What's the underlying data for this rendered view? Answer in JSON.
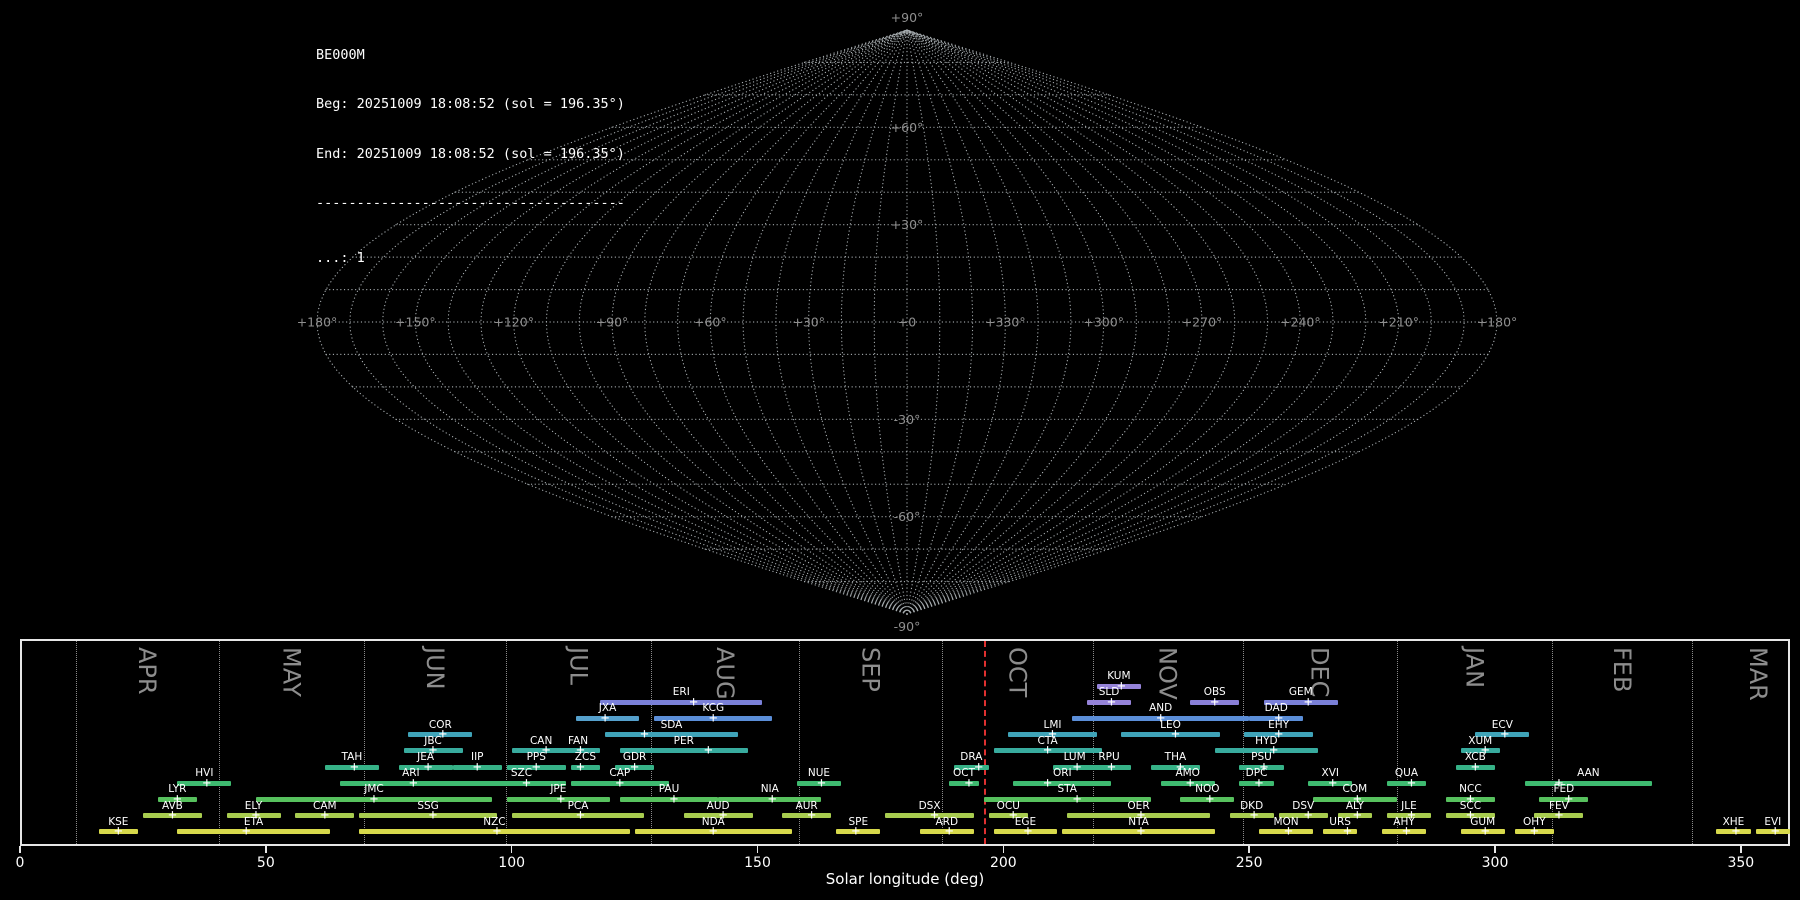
{
  "header": {
    "station": "BE000M",
    "beg_line": "Beg: 20251009 18:08:52 (sol = 196.35°)",
    "end_line": "End: 20251009 18:08:52 (sol = 196.35°)",
    "separator": "--------------------------------------",
    "legend_line": "...: 1"
  },
  "skymap": {
    "lon_labels": [
      {
        "off": -180,
        "label": "+180°"
      },
      {
        "off": -150,
        "label": "+150°"
      },
      {
        "off": -120,
        "label": "+120°"
      },
      {
        "off": -90,
        "label": "+90°"
      },
      {
        "off": -60,
        "label": "+60°"
      },
      {
        "off": -30,
        "label": "+30°"
      },
      {
        "off": 0,
        "label": "+0"
      },
      {
        "off": 30,
        "label": "+330°"
      },
      {
        "off": 60,
        "label": "+300°"
      },
      {
        "off": 90,
        "label": "+270°"
      },
      {
        "off": 120,
        "label": "+240°"
      },
      {
        "off": 150,
        "label": "+210°"
      },
      {
        "off": 180,
        "label": "+180°"
      }
    ],
    "lat_labels": [
      {
        "lat": 90,
        "label": "+90°"
      },
      {
        "lat": 60,
        "label": "+60°"
      },
      {
        "lat": 30,
        "label": "+30°"
      },
      {
        "lat": -30,
        "label": "-30°"
      },
      {
        "lat": -60,
        "label": "-60°"
      },
      {
        "lat": -90,
        "label": "-90°"
      }
    ]
  },
  "chart_data": {
    "type": "timeline",
    "title": "Meteor shower activity periods",
    "xlabel": "Solar longitude (deg)",
    "xlim": [
      0,
      360
    ],
    "x_ticks": [
      0,
      50,
      100,
      150,
      200,
      250,
      300,
      350
    ],
    "current_sol": 196.35,
    "months": [
      {
        "label": "APR",
        "start_sol": 11.3,
        "mid_sol": 25.8
      },
      {
        "label": "MAY",
        "start_sol": 40.4,
        "mid_sol": 55.2
      },
      {
        "label": "JUN",
        "start_sol": 70.0,
        "mid_sol": 84.4
      },
      {
        "label": "JUL",
        "start_sol": 98.8,
        "mid_sol": 113.6
      },
      {
        "label": "AUG",
        "start_sol": 128.4,
        "mid_sol": 143.4
      },
      {
        "label": "SEP",
        "start_sol": 158.4,
        "mid_sol": 173.0
      },
      {
        "label": "OCT",
        "start_sol": 187.6,
        "mid_sol": 202.9
      },
      {
        "label": "NOV",
        "start_sol": 218.2,
        "mid_sol": 233.4
      },
      {
        "label": "DEC",
        "start_sol": 248.7,
        "mid_sol": 264.3
      },
      {
        "label": "JAN",
        "start_sol": 280.0,
        "mid_sol": 295.8
      },
      {
        "label": "FEB",
        "start_sol": 311.6,
        "mid_sol": 325.8
      },
      {
        "label": "MAR",
        "start_sol": 340.0,
        "mid_sol": 353.5
      }
    ],
    "showers": [
      {
        "code": "KUM",
        "row": 1,
        "start": 219,
        "end": 228,
        "peak": 224,
        "color": "#9583d9"
      },
      {
        "code": "ERI",
        "row": 2,
        "start": 118,
        "end": 151,
        "peak": 137,
        "color": "#7a80d8"
      },
      {
        "code": "SLD",
        "row": 2,
        "start": 217,
        "end": 226,
        "peak": 222,
        "color": "#9583d9"
      },
      {
        "code": "OBS",
        "row": 2,
        "start": 238,
        "end": 248,
        "peak": 243,
        "color": "#8a80d8"
      },
      {
        "code": "GEM",
        "row": 2,
        "start": 253,
        "end": 268,
        "peak": 262,
        "color": "#7a80d8"
      },
      {
        "code": "JXA",
        "row": 3,
        "start": 113,
        "end": 126,
        "peak": 119,
        "color": "#55a0cc"
      },
      {
        "code": "KCG",
        "row": 3,
        "start": 129,
        "end": 153,
        "peak": 141,
        "color": "#5b8ed8"
      },
      {
        "code": "AND",
        "row": 3,
        "start": 214,
        "end": 250,
        "peak": 232,
        "color": "#5b8ed8"
      },
      {
        "code": "DAD",
        "row": 3,
        "start": 250,
        "end": 261,
        "peak": 256,
        "color": "#5b8ed8"
      },
      {
        "code": "COR",
        "row": 4,
        "start": 79,
        "end": 92,
        "peak": 86,
        "color": "#3fa3b8"
      },
      {
        "code": "SDA",
        "row": 4,
        "start": 119,
        "end": 146,
        "peak": 127,
        "color": "#3fa3b8"
      },
      {
        "code": "LMI",
        "row": 4,
        "start": 201,
        "end": 219,
        "peak": 210,
        "color": "#3fa3b8"
      },
      {
        "code": "LEO",
        "row": 4,
        "start": 224,
        "end": 244,
        "peak": 235,
        "color": "#3fa3b8"
      },
      {
        "code": "EHY",
        "row": 4,
        "start": 249,
        "end": 263,
        "peak": 256,
        "color": "#3fa3b8"
      },
      {
        "code": "ECV",
        "row": 4,
        "start": 296,
        "end": 307,
        "peak": 302,
        "color": "#3fa3b8"
      },
      {
        "code": "JBC",
        "row": 5,
        "start": 78,
        "end": 90,
        "peak": 84,
        "color": "#38ab9e"
      },
      {
        "code": "CAN",
        "row": 5,
        "start": 100,
        "end": 112,
        "peak": 107,
        "color": "#38ab9e"
      },
      {
        "code": "FAN",
        "row": 5,
        "start": 109,
        "end": 118,
        "peak": 114,
        "color": "#38ab9e"
      },
      {
        "code": "PER",
        "row": 5,
        "start": 122,
        "end": 148,
        "peak": 140,
        "color": "#38ab9e"
      },
      {
        "code": "CTA",
        "row": 5,
        "start": 198,
        "end": 220,
        "peak": 209,
        "color": "#38ab9e"
      },
      {
        "code": "HYD",
        "row": 5,
        "start": 243,
        "end": 264,
        "peak": 255,
        "color": "#38ab9e"
      },
      {
        "code": "XUM",
        "row": 5,
        "start": 293,
        "end": 301,
        "peak": 298,
        "color": "#38ab9e"
      },
      {
        "code": "TAH",
        "row": 6,
        "start": 62,
        "end": 73,
        "peak": 68,
        "color": "#36b287"
      },
      {
        "code": "JEA",
        "row": 6,
        "start": 77,
        "end": 88,
        "peak": 83,
        "color": "#36b287"
      },
      {
        "code": "IIP",
        "row": 6,
        "start": 88,
        "end": 98,
        "peak": 93,
        "color": "#36b287"
      },
      {
        "code": "PPS",
        "row": 6,
        "start": 99,
        "end": 111,
        "peak": 105,
        "color": "#36b287"
      },
      {
        "code": "ZCS",
        "row": 6,
        "start": 112,
        "end": 118,
        "peak": 114,
        "color": "#36b287"
      },
      {
        "code": "GDR",
        "row": 6,
        "start": 121,
        "end": 129,
        "peak": 125,
        "color": "#36b287"
      },
      {
        "code": "DRA",
        "row": 6,
        "start": 190,
        "end": 197,
        "peak": 195,
        "color": "#36b287"
      },
      {
        "code": "LUM",
        "row": 6,
        "start": 210,
        "end": 219,
        "peak": 215,
        "color": "#36b287"
      },
      {
        "code": "RPU",
        "row": 6,
        "start": 217,
        "end": 226,
        "peak": 222,
        "color": "#36b287"
      },
      {
        "code": "THA",
        "row": 6,
        "start": 230,
        "end": 240,
        "peak": 236,
        "color": "#36b287"
      },
      {
        "code": "PSU",
        "row": 6,
        "start": 248,
        "end": 257,
        "peak": 253,
        "color": "#36b287"
      },
      {
        "code": "XCB",
        "row": 6,
        "start": 292,
        "end": 300,
        "peak": 296,
        "color": "#36b287"
      },
      {
        "code": "HVI",
        "row": 7,
        "start": 32,
        "end": 43,
        "peak": 38,
        "color": "#3eba70"
      },
      {
        "code": "ARI",
        "row": 7,
        "start": 65,
        "end": 94,
        "peak": 80,
        "color": "#3eba70"
      },
      {
        "code": "SZC",
        "row": 7,
        "start": 93,
        "end": 111,
        "peak": 103,
        "color": "#3eba70"
      },
      {
        "code": "CAP",
        "row": 7,
        "start": 112,
        "end": 132,
        "peak": 122,
        "color": "#3eba70"
      },
      {
        "code": "NUE",
        "row": 7,
        "start": 158,
        "end": 167,
        "peak": 163,
        "color": "#3eba70"
      },
      {
        "code": "OCT",
        "row": 7,
        "start": 189,
        "end": 195,
        "peak": 193,
        "color": "#3eba70"
      },
      {
        "code": "ORI",
        "row": 7,
        "start": 202,
        "end": 222,
        "peak": 209,
        "color": "#3eba70"
      },
      {
        "code": "AMO",
        "row": 7,
        "start": 232,
        "end": 243,
        "peak": 238,
        "color": "#3eba70"
      },
      {
        "code": "DPC",
        "row": 7,
        "start": 248,
        "end": 255,
        "peak": 252,
        "color": "#3eba70"
      },
      {
        "code": "XVI",
        "row": 7,
        "start": 262,
        "end": 271,
        "peak": 267,
        "color": "#3eba70"
      },
      {
        "code": "QUA",
        "row": 7,
        "start": 278,
        "end": 286,
        "peak": 283,
        "color": "#3eba70"
      },
      {
        "code": "AAN",
        "row": 7,
        "start": 306,
        "end": 332,
        "peak": 313,
        "color": "#3eba70"
      },
      {
        "code": "LYR",
        "row": 8,
        "start": 28,
        "end": 36,
        "peak": 32,
        "color": "#57c15e"
      },
      {
        "code": "JMC",
        "row": 8,
        "start": 48,
        "end": 96,
        "peak": 72,
        "color": "#57c15e"
      },
      {
        "code": "JPE",
        "row": 8,
        "start": 99,
        "end": 120,
        "peak": 110,
        "color": "#57c15e"
      },
      {
        "code": "PAU",
        "row": 8,
        "start": 122,
        "end": 142,
        "peak": 133,
        "color": "#57c15e"
      },
      {
        "code": "NIA",
        "row": 8,
        "start": 142,
        "end": 163,
        "peak": 153,
        "color": "#57c15e"
      },
      {
        "code": "STA",
        "row": 8,
        "start": 196,
        "end": 230,
        "peak": 215,
        "color": "#57c15e"
      },
      {
        "code": "NOO",
        "row": 8,
        "start": 236,
        "end": 247,
        "peak": 242,
        "color": "#57c15e"
      },
      {
        "code": "COM",
        "row": 8,
        "start": 263,
        "end": 280,
        "peak": 272,
        "color": "#57c15e"
      },
      {
        "code": "NCC",
        "row": 8,
        "start": 290,
        "end": 300,
        "peak": 295,
        "color": "#57c15e"
      },
      {
        "code": "FED",
        "row": 8,
        "start": 309,
        "end": 319,
        "peak": 315,
        "color": "#57c15e"
      },
      {
        "code": "AVB",
        "row": 9,
        "start": 25,
        "end": 37,
        "peak": 31,
        "color": "#a8cc4f"
      },
      {
        "code": "ELY",
        "row": 9,
        "start": 42,
        "end": 53,
        "peak": 48,
        "color": "#a8cc4f"
      },
      {
        "code": "CAM",
        "row": 9,
        "start": 56,
        "end": 68,
        "peak": 62,
        "color": "#a8cc4f"
      },
      {
        "code": "SSG",
        "row": 9,
        "start": 69,
        "end": 97,
        "peak": 84,
        "color": "#a8cc4f"
      },
      {
        "code": "PCA",
        "row": 9,
        "start": 100,
        "end": 127,
        "peak": 114,
        "color": "#a8cc4f"
      },
      {
        "code": "AUD",
        "row": 9,
        "start": 135,
        "end": 149,
        "peak": 143,
        "color": "#a8cc4f"
      },
      {
        "code": "AUR",
        "row": 9,
        "start": 155,
        "end": 165,
        "peak": 161,
        "color": "#a8cc4f"
      },
      {
        "code": "DSX",
        "row": 9,
        "start": 176,
        "end": 194,
        "peak": 186,
        "color": "#a8cc4f"
      },
      {
        "code": "OCU",
        "row": 9,
        "start": 197,
        "end": 205,
        "peak": 202,
        "color": "#a8cc4f"
      },
      {
        "code": "OER",
        "row": 9,
        "start": 213,
        "end": 242,
        "peak": 228,
        "color": "#a8cc4f"
      },
      {
        "code": "DKD",
        "row": 9,
        "start": 246,
        "end": 255,
        "peak": 251,
        "color": "#a8cc4f"
      },
      {
        "code": "DSV",
        "row": 9,
        "start": 256,
        "end": 266,
        "peak": 262,
        "color": "#a8cc4f"
      },
      {
        "code": "ALY",
        "row": 9,
        "start": 268,
        "end": 275,
        "peak": 272,
        "color": "#a8cc4f"
      },
      {
        "code": "JLE",
        "row": 9,
        "start": 278,
        "end": 287,
        "peak": 283,
        "color": "#a8cc4f"
      },
      {
        "code": "SCC",
        "row": 9,
        "start": 290,
        "end": 300,
        "peak": 295,
        "color": "#a8cc4f"
      },
      {
        "code": "FEV",
        "row": 9,
        "start": 308,
        "end": 318,
        "peak": 313,
        "color": "#a8cc4f"
      },
      {
        "code": "KSE",
        "row": 10,
        "start": 16,
        "end": 24,
        "peak": 20,
        "color": "#d7d94b"
      },
      {
        "code": "ETA",
        "row": 10,
        "start": 32,
        "end": 63,
        "peak": 46,
        "color": "#d7d94b"
      },
      {
        "code": "NZC",
        "row": 10,
        "start": 69,
        "end": 124,
        "peak": 97,
        "color": "#d7d94b"
      },
      {
        "code": "NDA",
        "row": 10,
        "start": 125,
        "end": 157,
        "peak": 141,
        "color": "#d7d94b"
      },
      {
        "code": "SPE",
        "row": 10,
        "start": 166,
        "end": 175,
        "peak": 170,
        "color": "#d7d94b"
      },
      {
        "code": "ARD",
        "row": 10,
        "start": 183,
        "end": 194,
        "peak": 189,
        "color": "#d7d94b"
      },
      {
        "code": "EGE",
        "row": 10,
        "start": 198,
        "end": 211,
        "peak": 205,
        "color": "#d7d94b"
      },
      {
        "code": "NTA",
        "row": 10,
        "start": 212,
        "end": 243,
        "peak": 228,
        "color": "#d7d94b"
      },
      {
        "code": "MON",
        "row": 10,
        "start": 252,
        "end": 263,
        "peak": 258,
        "color": "#d7d94b"
      },
      {
        "code": "URS",
        "row": 10,
        "start": 265,
        "end": 272,
        "peak": 270,
        "color": "#d7d94b"
      },
      {
        "code": "AHY",
        "row": 10,
        "start": 277,
        "end": 286,
        "peak": 282,
        "color": "#d7d94b"
      },
      {
        "code": "GUM",
        "row": 10,
        "start": 293,
        "end": 302,
        "peak": 298,
        "color": "#d7d94b"
      },
      {
        "code": "OHY",
        "row": 10,
        "start": 304,
        "end": 312,
        "peak": 308,
        "color": "#d7d94b"
      },
      {
        "code": "XHE",
        "row": 10,
        "start": 345,
        "end": 352,
        "peak": 349,
        "color": "#d7d94b"
      },
      {
        "code": "EVI",
        "row": 10,
        "start": 353,
        "end": 360,
        "peak": 357,
        "color": "#d7d94b"
      }
    ]
  }
}
